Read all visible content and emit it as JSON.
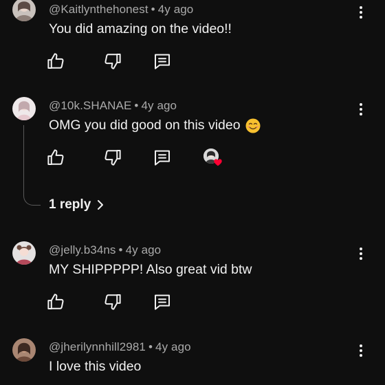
{
  "comments": [
    {
      "author": "@Kaitlynthehonest",
      "separator": "•",
      "time": "4y ago",
      "text": "You did amazing on the video!!",
      "avatar_icon": "user-avatar-photo"
    },
    {
      "author": "@10k.SHANAE",
      "separator": "•",
      "time": "4y ago",
      "text": "OMG you did good on this video",
      "emoji_icon": "smiling-face-emoji",
      "avatar_icon": "user-avatar-photo",
      "creator_heart": true,
      "replies_label": "1 reply"
    },
    {
      "author": "@jelly.b34ns",
      "separator": "•",
      "time": "4y ago",
      "text": "MY SHIPPPPP! Also great vid btw",
      "avatar_icon": "user-avatar-photo"
    },
    {
      "author": "@jherilynnhill2981",
      "separator": "•",
      "time": "4y ago",
      "text": "I love this video",
      "avatar_icon": "user-avatar-photo"
    }
  ],
  "icons": {
    "like": "thumbs-up-icon",
    "dislike": "thumbs-down-icon",
    "reply": "reply-comment-icon",
    "more": "more-vertical-icon",
    "heart": "creator-heart-icon",
    "chevron": "chevron-right-icon"
  },
  "colors": {
    "background": "#0f0f0f",
    "text_primary": "#f1f1f1",
    "text_secondary": "#aaaaaa",
    "heart": "#ff0033"
  }
}
